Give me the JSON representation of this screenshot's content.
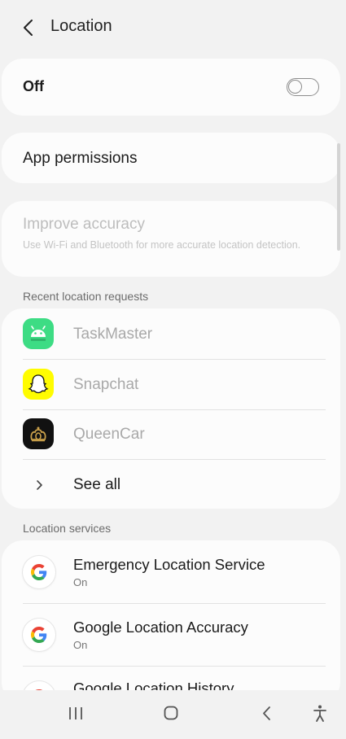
{
  "header": {
    "title": "Location"
  },
  "master_toggle": {
    "label": "Off",
    "state": "off"
  },
  "app_permissions": {
    "label": "App permissions"
  },
  "improve_accuracy": {
    "title": "Improve accuracy",
    "subtitle": "Use Wi-Fi and Bluetooth for more accurate location detection."
  },
  "recent_requests": {
    "header": "Recent location requests",
    "apps": [
      {
        "name": "TaskMaster",
        "icon": "android-icon"
      },
      {
        "name": "Snapchat",
        "icon": "snapchat-ghost-icon"
      },
      {
        "name": "QueenCar",
        "icon": "queencar-crown-icon"
      }
    ],
    "see_all": "See all"
  },
  "location_services": {
    "header": "Location services",
    "items": [
      {
        "name": "Emergency Location Service",
        "status": "On",
        "icon": "google-g-icon"
      },
      {
        "name": "Google Location Accuracy",
        "status": "On",
        "icon": "google-g-icon"
      },
      {
        "name": "Google Location History",
        "status": "",
        "icon": "google-g-icon"
      }
    ]
  },
  "navbar": {
    "buttons": [
      "recent-apps",
      "home",
      "back",
      "accessibility"
    ]
  },
  "colors": {
    "background": "#f2f2f2",
    "card": "#fcfcfc",
    "taskmaster_green": "#3ddc84",
    "snapchat_yellow": "#fffc00",
    "queencar_black": "#111111",
    "queencar_gold": "#c9a04a"
  }
}
